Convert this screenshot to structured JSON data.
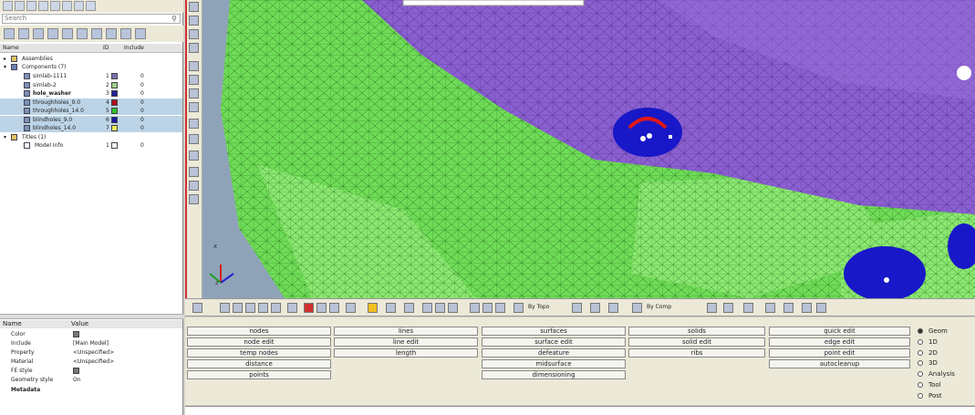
{
  "search": {
    "placeholder": "Search"
  },
  "tree": {
    "headers": {
      "name": "Name",
      "id": "ID",
      "include": "Include"
    },
    "assemblies": "Assemblies",
    "components": "Components (7)",
    "items": [
      {
        "label": "simlab-1111",
        "id": "1",
        "color": "#7a6fb0",
        "include": "0",
        "bold": false,
        "selected": false
      },
      {
        "label": "simlab-2",
        "id": "2",
        "color": "#9fd08a",
        "include": "0",
        "bold": false,
        "selected": false
      },
      {
        "label": "hole_washer",
        "id": "3",
        "color": "#222299",
        "include": "0",
        "bold": true,
        "selected": false
      },
      {
        "label": "throughholes_9.0",
        "id": "4",
        "color": "#b01020",
        "include": "0",
        "bold": false,
        "selected": true
      },
      {
        "label": "throughholes_14.0",
        "id": "5",
        "color": "#30c030",
        "include": "0",
        "bold": false,
        "selected": true
      },
      {
        "label": "blindholes_9.0",
        "id": "6",
        "color": "#1a1aa0",
        "include": "0",
        "bold": false,
        "selected": true
      },
      {
        "label": "blindholes_14.0",
        "id": "7",
        "color": "#e8e860",
        "include": "0",
        "bold": false,
        "selected": true
      }
    ],
    "titles": "Titles (1)",
    "model_info": {
      "label": "Model Info",
      "id": "1",
      "include": "0"
    }
  },
  "props": {
    "header_name": "Name",
    "header_value": "Value",
    "rows": [
      {
        "k": "Color",
        "v": ""
      },
      {
        "k": "Include",
        "v": "[Main Model]"
      },
      {
        "k": "Property",
        "v": "<Unspecified>"
      },
      {
        "k": "Material",
        "v": "<Unspecified>"
      },
      {
        "k": "FE style",
        "v": ""
      },
      {
        "k": "Geometry style",
        "v": "On"
      }
    ],
    "metadata": "Metadata"
  },
  "toolbar": {
    "by_topo": "By Topo",
    "by_comp": "By Comp"
  },
  "panel": {
    "columns": [
      [
        "nodes",
        "node edit",
        "temp nodes",
        "distance",
        "points"
      ],
      [
        "lines",
        "line edit",
        "length"
      ],
      [
        "surfaces",
        "surface edit",
        "defeature",
        "midsurface",
        "dimensioning"
      ],
      [
        "solids",
        "solid edit",
        "ribs"
      ],
      [
        "quick edit",
        "edge edit",
        "point edit",
        "autocleanup"
      ]
    ],
    "radios": [
      "Geom",
      "1D",
      "2D",
      "3D",
      "Analysis",
      "Tool",
      "Post"
    ],
    "selected_radio": "Geom"
  },
  "triad": {
    "x": "x",
    "z": "z"
  }
}
